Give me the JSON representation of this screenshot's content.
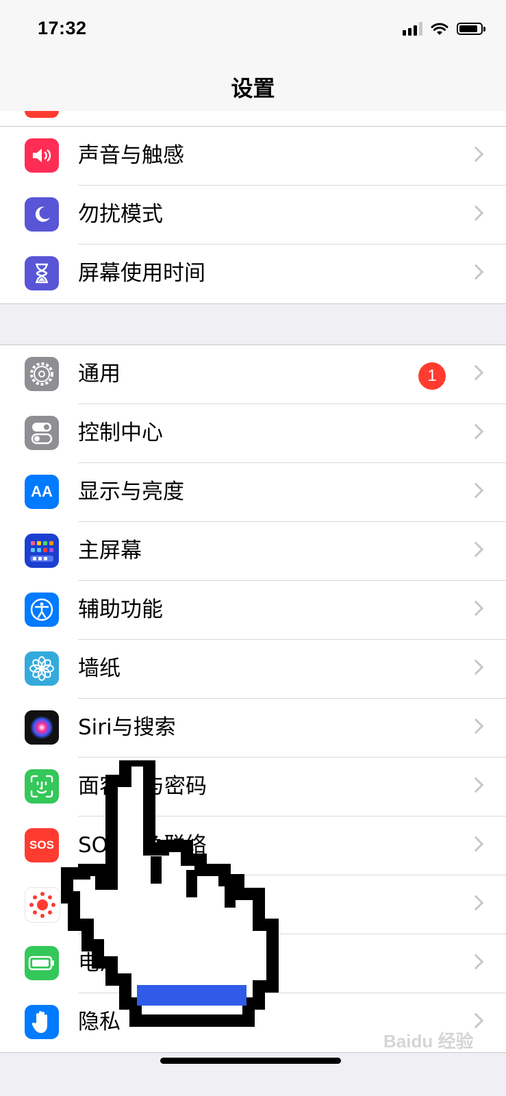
{
  "status": {
    "time": "17:32"
  },
  "nav": {
    "title": "设置"
  },
  "group1": [
    {
      "id": "sounds",
      "label": "声音与触感",
      "icon": "speaker-icon",
      "color": "#ff2d55"
    },
    {
      "id": "dnd",
      "label": "勿扰模式",
      "icon": "moon-icon",
      "color": "#5856d6"
    },
    {
      "id": "screentime",
      "label": "屏幕使用时间",
      "icon": "hourglass-icon",
      "color": "#5856d6"
    }
  ],
  "group2": [
    {
      "id": "general",
      "label": "通用",
      "icon": "gear-icon",
      "color": "#8e8e93",
      "badge": "1"
    },
    {
      "id": "control",
      "label": "控制中心",
      "icon": "toggle-icon",
      "color": "#8e8e93"
    },
    {
      "id": "display",
      "label": "显示与亮度",
      "icon": "text-size-icon",
      "color": "#007aff",
      "glyph": "AA"
    },
    {
      "id": "homescreen",
      "label": "主屏幕",
      "icon": "app-grid-icon",
      "color": "#1c3fcf"
    },
    {
      "id": "accessibility",
      "label": "辅助功能",
      "icon": "accessibility-icon",
      "color": "#007aff"
    },
    {
      "id": "wallpaper",
      "label": "墙纸",
      "icon": "flower-icon",
      "color": "#34aadc"
    },
    {
      "id": "siri",
      "label": "Siri与搜索",
      "icon": "siri-icon",
      "color": "#222"
    },
    {
      "id": "faceid",
      "label": "面容ID与密码",
      "icon": "face-id-icon",
      "color": "#34c759"
    },
    {
      "id": "sos",
      "label": "SOS紧急联络",
      "icon": "sos-icon",
      "color": "#ff3b30",
      "glyph": "SOS"
    },
    {
      "id": "exposure",
      "label": "暴露通知",
      "icon": "exposure-icon",
      "color": "#ffffff"
    },
    {
      "id": "battery",
      "label": "电池",
      "icon": "battery-icon",
      "color": "#34c759"
    },
    {
      "id": "privacy",
      "label": "隐私",
      "icon": "hand-icon",
      "color": "#007aff"
    }
  ],
  "watermark": "Baidu 经验"
}
